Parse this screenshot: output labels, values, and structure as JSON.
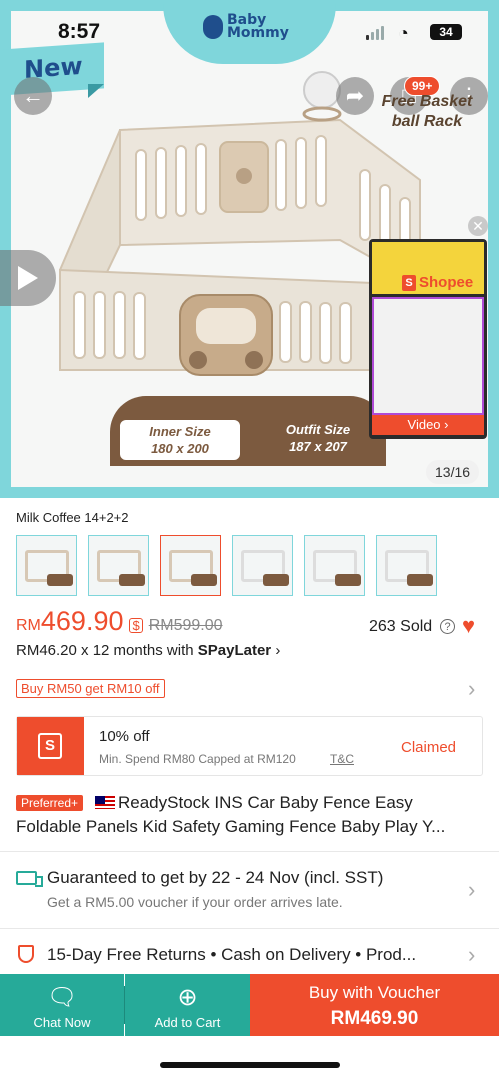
{
  "status_bar": {
    "time": "8:57",
    "battery": "34"
  },
  "hero": {
    "brand": "Baby\nMommy",
    "ribbon": "New",
    "cart_badge": "99+",
    "basket_caption": "Free Basket ball Rack",
    "inner_size_label": "Inner Size",
    "inner_size_value": "180 x 200",
    "outfit_size_label": "Outfit Size",
    "outfit_size_value": "187 x 207",
    "page_indicator": "13/16",
    "video": {
      "store": "Shopee",
      "button": "Video ›"
    }
  },
  "product": {
    "variant_name": "Milk Coffee 14+2+2",
    "thumbnail_count": 6,
    "selected_thumbnail": 2,
    "price_currency": "RM",
    "price": "469.90",
    "original_price": "RM599.00",
    "sold": "263 Sold",
    "installment_prefix": "RM46.20 x 12 months with ",
    "installment_brand": "SPayLater",
    "promo_tag": "Buy RM50 get RM10 off",
    "voucher": {
      "title": "10% off",
      "subtitle": "Min. Spend RM80 Capped at RM120",
      "tc": "T&C",
      "status": "Claimed"
    },
    "badge": "Preferred+",
    "title_line1": "ReadyStock INS Car Baby Fence Easy",
    "title_line2": "Foldable  Panels Kid Safety Gaming Fence Baby Play Y..."
  },
  "shipping": {
    "title": "Guaranteed to get by 22 - 24 Nov (incl. SST)",
    "subtitle": "Get a RM5.00 voucher if your order arrives late."
  },
  "services": {
    "text": "15-Day Free Returns  •  Cash on Delivery  •  Prod..."
  },
  "bottom_bar": {
    "chat_label": "Chat Now",
    "cart_label": "Add to Cart",
    "buy_label": "Buy with Voucher",
    "buy_price": "RM469.90"
  },
  "colors": {
    "accent": "#ee4d2d",
    "teal": "#26aa99",
    "hero_frame": "#7fd6db",
    "fence_brown": "#7c5a3f"
  },
  "icons": [
    "back-arrow-icon",
    "share-icon",
    "cart-icon",
    "more-icon",
    "play-icon",
    "close-icon",
    "help-icon",
    "heart-icon",
    "chevron-right-icon",
    "shopee-bag-icon",
    "truck-icon",
    "shield-icon",
    "chat-icon",
    "add-cart-icon"
  ]
}
